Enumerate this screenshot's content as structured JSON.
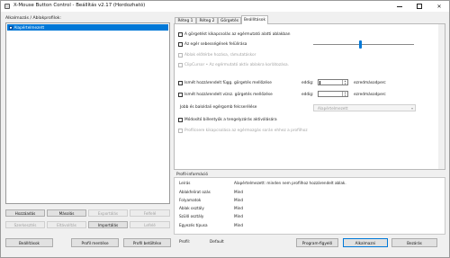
{
  "window": {
    "title": "X-Mouse Button Control - Beállítás v2.17 (Hordozható)",
    "minimize_glyph": "",
    "maximize_glyph": "",
    "close_glyph": "✕"
  },
  "apps_panel": {
    "label": "Alkalmazás / Ablakprofilok:",
    "items": [
      {
        "label": "Alapértelmezett",
        "checked": true,
        "selected": true
      }
    ],
    "buttons": {
      "add": "Hozzáadás",
      "copy": "Másolás",
      "export": "Exportálás",
      "up": "Felfelé",
      "edit": "Szerkesztés",
      "remove": "Eltávolítás",
      "import": "Importálás",
      "down": "Lefelé"
    }
  },
  "tabs": [
    {
      "label": "Réteg 1",
      "active": false
    },
    {
      "label": "Réteg 2",
      "active": false
    },
    {
      "label": "Görgetés",
      "active": false
    },
    {
      "label": "Beállítások",
      "active": true
    }
  ],
  "settings": {
    "opt_scroll_lock": "A görgetést kikapcsolás az egérmutató alatti ablakban",
    "opt_speed": "Az egér sebességének felülírása",
    "opt_foreground": "Ablak előtérbe hozása, rámutatáskor",
    "opt_clipcursor": "ClipCursor • Az egérmutató aktív ablakra korlátozása.",
    "opt_repeat_vertical": "Ismét hozzárendelt függ. görgetés mellőzése",
    "opt_repeat_horizontal": "Ismét hozzárendelt vízsz. görgetés mellőzése",
    "until_label": "eddig:",
    "ms_label": "ezredmásodperc",
    "combo_label": "Jobb és baloldali egérgomb felcserélése",
    "combo_value": "Alapértelmezett",
    "opt_modifier": "Módosító billentyűk a tengelyzárás aktiválására",
    "opt_profile_switch": "Profilcsere kikapcsolása az egérmozgás során ehhez a profilhoz",
    "speed_slider_fraction": 0.47
  },
  "profile_info": {
    "title": "Profil-információ",
    "rows": [
      {
        "key": "Leírás",
        "value": "Alapértelmezett: minden nem profilhoz hozzárendelt ablak."
      },
      {
        "key": "Ablakfelirat ozás",
        "value": "Mind"
      },
      {
        "key": "Folyamatok",
        "value": "Mind"
      },
      {
        "key": "Ablak osztály",
        "value": "Mind"
      },
      {
        "key": "Szülő osztály",
        "value": "Mind"
      },
      {
        "key": "Egyezés típusa",
        "value": "Mind"
      }
    ]
  },
  "bottom_bar": {
    "settings": "Beállítások",
    "save_profile": "Profil mentése",
    "load_profile": "Profil betöltése",
    "profile_label": "Profil:",
    "profile_value": "Default",
    "program_log": "Program-figyelő",
    "apply": "Alkalmazni",
    "close": "Bezárás"
  },
  "colors": {
    "selection": "#0078d7",
    "window_bg": "#f0f0f0",
    "panel_bg": "#ffffff"
  }
}
